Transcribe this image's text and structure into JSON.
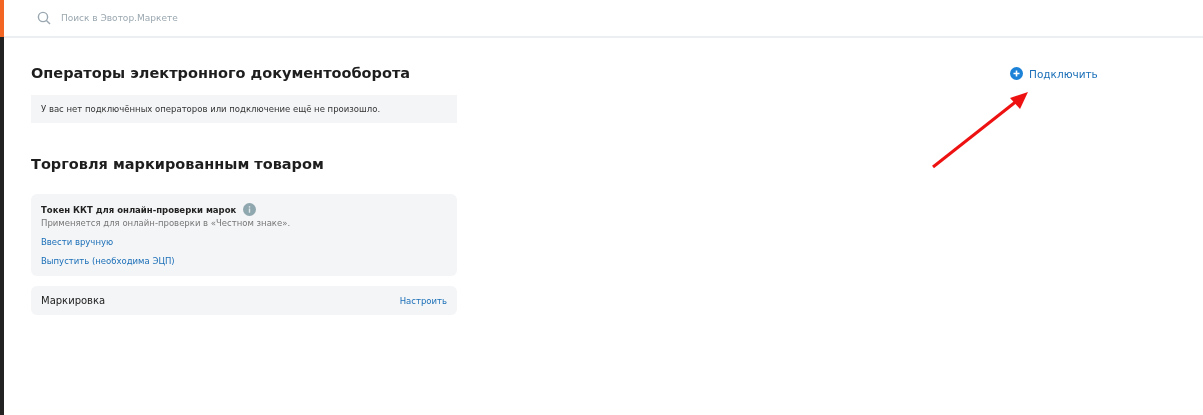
{
  "search": {
    "placeholder": "Поиск в Эвотор.Маркете"
  },
  "edo": {
    "title": "Операторы электронного документооборота",
    "connect": "Подключить",
    "empty": "У вас нет подключённых операторов или подключение ещё не произошло."
  },
  "marking": {
    "title": "Торговля маркированным товаром",
    "token": {
      "title": "Токен ККТ для онлайн-проверки марок",
      "description": "Применяется для онлайн-проверки в «Честном знаке».",
      "links": [
        "Ввести вручную",
        "Выпустить (необходима ЭЦП)"
      ]
    },
    "setting": {
      "label": "Маркировка",
      "action": "Настроить"
    }
  }
}
